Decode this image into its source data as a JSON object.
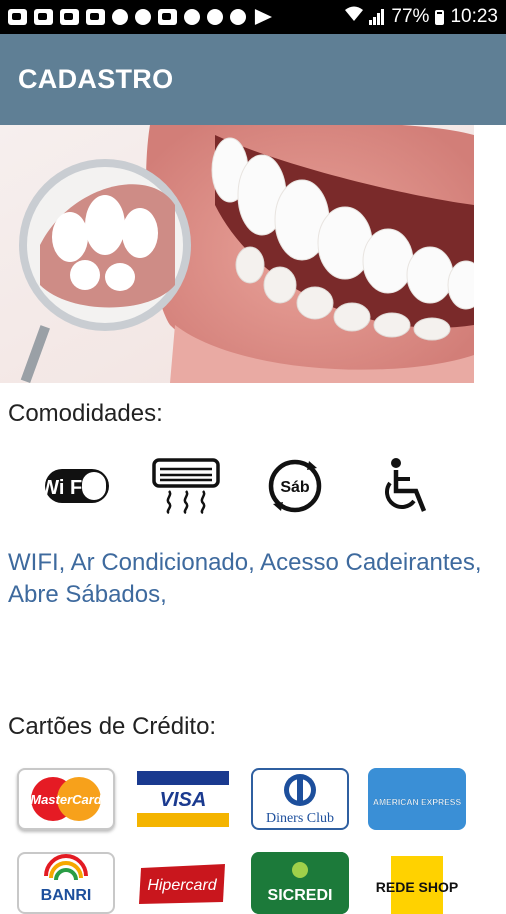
{
  "status_bar": {
    "battery": "77%",
    "time": "10:23",
    "icons": [
      "notification-icon",
      "youtube-icon",
      "gallery-icon",
      "mail-icon",
      "bug-icon",
      "chat-icon",
      "instagram-icon",
      "bird-icon",
      "whatsapp-icon",
      "fire-icon",
      "play-icon"
    ]
  },
  "app_bar": {
    "title": "CADASTRO"
  },
  "amenities": {
    "heading": "Comodidades:",
    "icons": [
      {
        "name": "wifi-icon",
        "label": "Wi Fi"
      },
      {
        "name": "air-conditioner-icon",
        "label": ""
      },
      {
        "name": "open-saturday-icon",
        "label": "Sáb"
      },
      {
        "name": "wheelchair-icon",
        "label": ""
      }
    ],
    "text": "WIFI, Ar Condicionado, Acesso Cadeirantes, Abre Sábados,"
  },
  "credit_cards": {
    "heading": "Cartões de Crédito:",
    "cards": [
      {
        "name": "mastercard",
        "label": "MasterCard"
      },
      {
        "name": "visa",
        "label": "VISA"
      },
      {
        "name": "diners-club",
        "label": "Diners Club"
      },
      {
        "name": "american-express",
        "label": "AMERICAN EXPRESS"
      },
      {
        "name": "banri",
        "label": "BANRI"
      },
      {
        "name": "hipercard",
        "label": "Hipercard"
      },
      {
        "name": "sicredi",
        "label": "SICREDI"
      },
      {
        "name": "rede-shop",
        "label": "REDE SHOP"
      }
    ]
  },
  "colors": {
    "app_bar": "#5f7f95",
    "link_text": "#3e6a9e"
  }
}
